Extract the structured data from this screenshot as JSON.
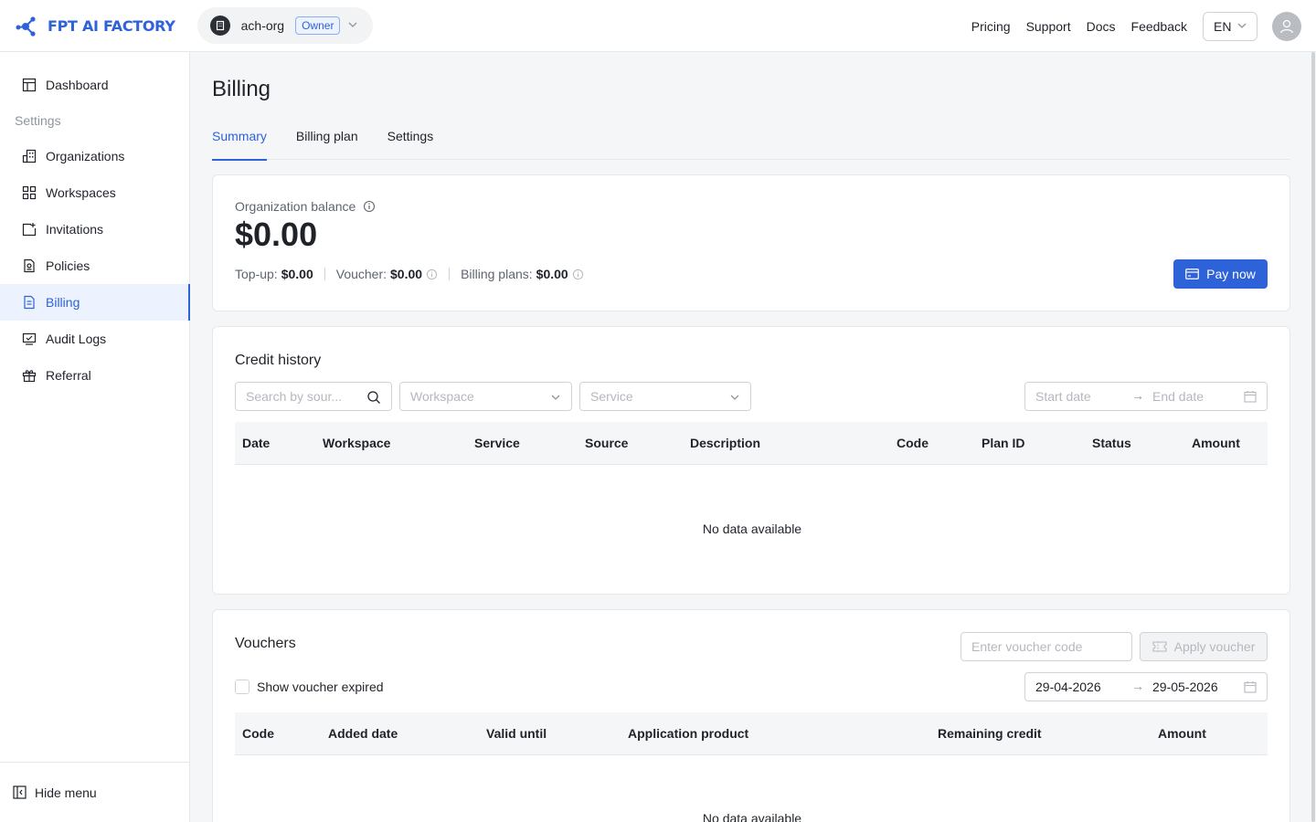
{
  "header": {
    "brand": "FPT AI FACTORY",
    "org_name": "ach-org",
    "org_role": "Owner",
    "nav": [
      "Pricing",
      "Support",
      "Docs",
      "Feedback"
    ],
    "language": "EN"
  },
  "sidebar": {
    "dashboard": "Dashboard",
    "section_label": "Settings",
    "items": [
      "Organizations",
      "Workspaces",
      "Invitations",
      "Policies",
      "Billing",
      "Audit Logs",
      "Referral"
    ],
    "active": "Billing",
    "hide_menu": "Hide menu"
  },
  "page": {
    "title": "Billing",
    "tabs": [
      "Summary",
      "Billing plan",
      "Settings"
    ],
    "active_tab": "Summary"
  },
  "balance": {
    "label": "Organization balance",
    "amount": "$0.00",
    "topup_label": "Top-up:",
    "topup_value": "$0.00",
    "voucher_label": "Voucher:",
    "voucher_value": "$0.00",
    "plans_label": "Billing plans:",
    "plans_value": "$0.00",
    "pay_button": "Pay now"
  },
  "credit_history": {
    "title": "Credit history",
    "search_placeholder": "Search by sour...",
    "workspace_placeholder": "Workspace",
    "service_placeholder": "Service",
    "start_placeholder": "Start date",
    "end_placeholder": "End date",
    "columns": [
      "Date",
      "Workspace",
      "Service",
      "Source",
      "Description",
      "Code",
      "Plan ID",
      "Status",
      "Amount"
    ],
    "empty_text": "No data available"
  },
  "vouchers": {
    "title": "Vouchers",
    "code_placeholder": "Enter voucher code",
    "apply_button": "Apply voucher",
    "show_expired": "Show voucher expired",
    "start_date": "29-04-2026",
    "end_date": "29-05-2026",
    "columns": [
      "Code",
      "Added date",
      "Valid until",
      "Application product",
      "Remaining credit",
      "Amount"
    ],
    "empty_text": "No data available"
  },
  "colors": {
    "accent": "#2e62d9",
    "accent_bg": "#ecf2fe",
    "border": "#e5e7eb"
  }
}
